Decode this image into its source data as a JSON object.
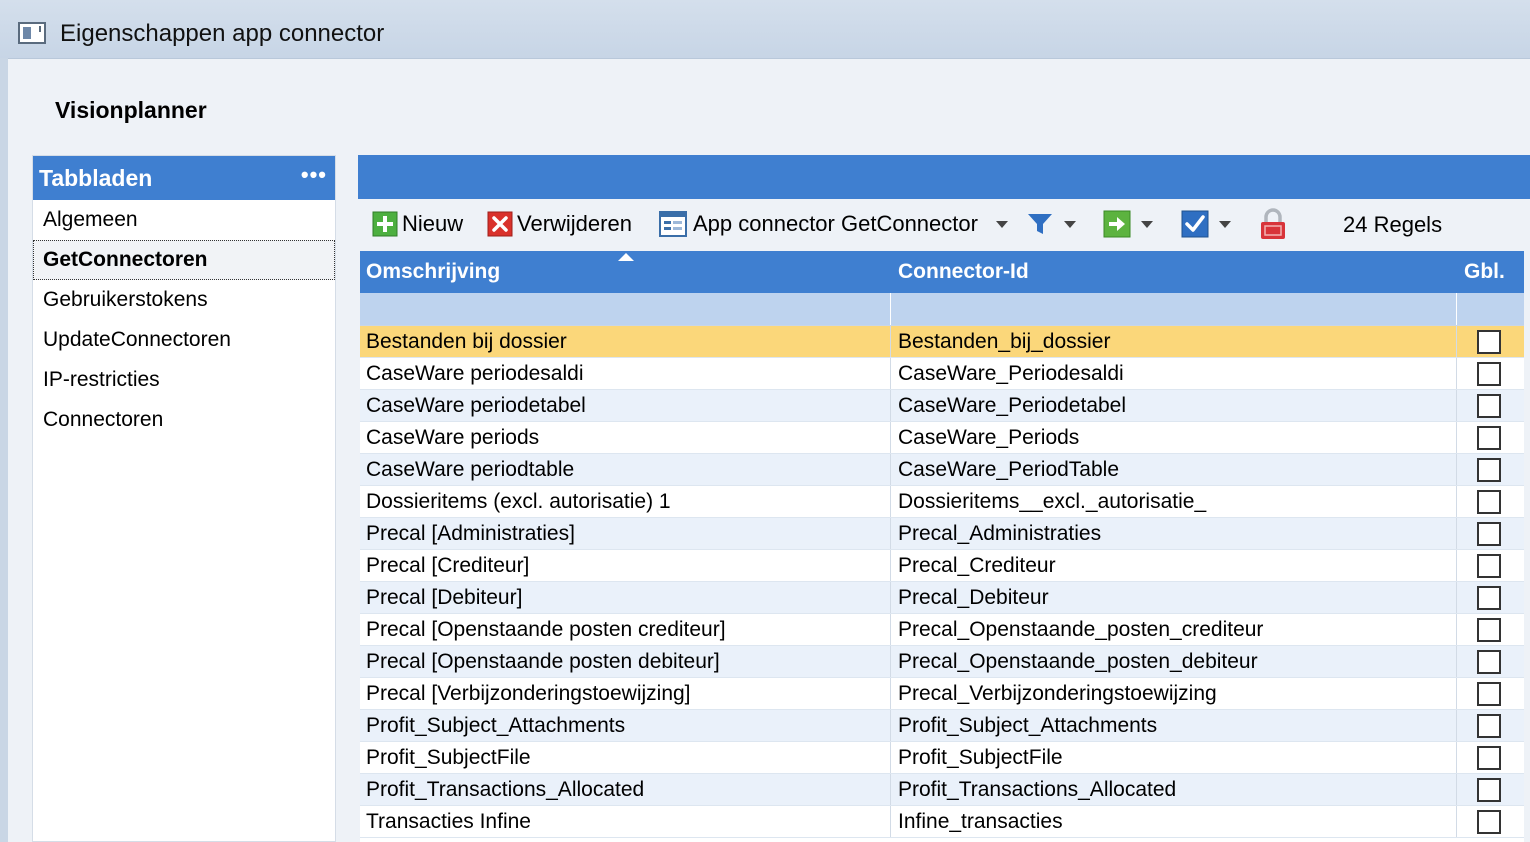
{
  "window": {
    "title": "Eigenschappen app connector"
  },
  "header": {
    "title": "Visionplanner"
  },
  "sidebar": {
    "title": "Tabbladen",
    "more": "•••",
    "items": [
      {
        "label": "Algemeen"
      },
      {
        "label": "GetConnectoren",
        "active": true
      },
      {
        "label": "Gebruikerstokens"
      },
      {
        "label": "UpdateConnectoren"
      },
      {
        "label": "IP-restricties"
      },
      {
        "label": "Connectoren"
      }
    ]
  },
  "toolbar": {
    "new_label": "Nieuw",
    "delete_label": "Verwijderen",
    "connector_label": "App connector GetConnector",
    "count_label": "24 Regels",
    "icons": [
      "add-icon",
      "delete-icon",
      "form-icon",
      "filter-icon",
      "export-icon",
      "checkmark-icon",
      "lock-icon"
    ],
    "colors": {
      "accent": "#3f7fd0",
      "add": "#4caf3f",
      "delete": "#d9312b",
      "selected_row": "#fbd77a"
    }
  },
  "grid": {
    "columns": [
      {
        "label": "Omschrijving"
      },
      {
        "label": "Connector-Id"
      },
      {
        "label": "Gbl."
      }
    ],
    "rows": [
      {
        "omschrijving": "Bestanden bij dossier",
        "connector_id": "Bestanden_bij_dossier",
        "gbl": false,
        "selected": true
      },
      {
        "omschrijving": "CaseWare periodesaldi",
        "connector_id": "CaseWare_Periodesaldi",
        "gbl": false
      },
      {
        "omschrijving": "CaseWare periodetabel",
        "connector_id": "CaseWare_Periodetabel",
        "gbl": false
      },
      {
        "omschrijving": "CaseWare periods",
        "connector_id": "CaseWare_Periods",
        "gbl": false
      },
      {
        "omschrijving": "CaseWare periodtable",
        "connector_id": "CaseWare_PeriodTable",
        "gbl": false
      },
      {
        "omschrijving": "Dossieritems (excl. autorisatie) 1",
        "connector_id": "Dossieritems__excl._autorisatie_",
        "gbl": false
      },
      {
        "omschrijving": "Precal [Administraties]",
        "connector_id": "Precal_Administraties",
        "gbl": false
      },
      {
        "omschrijving": "Precal [Crediteur]",
        "connector_id": "Precal_Crediteur",
        "gbl": false
      },
      {
        "omschrijving": "Precal [Debiteur]",
        "connector_id": "Precal_Debiteur",
        "gbl": false
      },
      {
        "omschrijving": "Precal [Openstaande posten crediteur]",
        "connector_id": "Precal_Openstaande_posten_crediteur",
        "gbl": false
      },
      {
        "omschrijving": "Precal [Openstaande posten debiteur]",
        "connector_id": "Precal_Openstaande_posten_debiteur",
        "gbl": false
      },
      {
        "omschrijving": "Precal [Verbijzonderingstoewijzing]",
        "connector_id": "Precal_Verbijzonderingstoewijzing",
        "gbl": false
      },
      {
        "omschrijving": "Profit_Subject_Attachments",
        "connector_id": "Profit_Subject_Attachments",
        "gbl": false
      },
      {
        "omschrijving": "Profit_SubjectFile",
        "connector_id": "Profit_SubjectFile",
        "gbl": false
      },
      {
        "omschrijving": "Profit_Transactions_Allocated",
        "connector_id": "Profit_Transactions_Allocated",
        "gbl": false
      },
      {
        "omschrijving": "Transacties Infine",
        "connector_id": "Infine_transacties",
        "gbl": false
      }
    ]
  }
}
